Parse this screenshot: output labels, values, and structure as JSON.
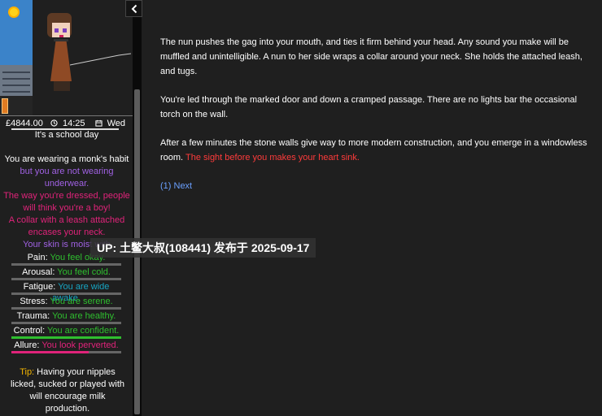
{
  "sidebar": {
    "money": "£4844.00",
    "time": "14:25",
    "weekday": "Wed",
    "day_note": "It's a school day",
    "desc": [
      {
        "text": "You are wearing a monk's habit",
        "color": "white"
      },
      {
        "text": " but you are not wearing underwear.",
        "color": "purple"
      },
      {
        "text": "The way you're dressed, people will think you're a boy!",
        "color": "pink"
      },
      {
        "text": "A collar with a leash attached encases your neck.",
        "color": "pink"
      },
      {
        "text": "Your skin is moist with",
        "color": "purple"
      }
    ],
    "stats": [
      {
        "name": "Pain",
        "sep": ": ",
        "value": "You feel okay.",
        "color": "green",
        "level": 0
      },
      {
        "name": "Arousal",
        "sep": ": ",
        "value": "You feel cold.",
        "color": "green",
        "level": 0
      },
      {
        "name": "Fatigue",
        "sep": ": ",
        "value": "You are wide awake.",
        "color": "teal",
        "level": 0
      },
      {
        "name": "Stress",
        "sep": ": ",
        "value": "You are serene.",
        "color": "green",
        "level": 0
      },
      {
        "name": "Trauma",
        "sep": ": ",
        "value": "You are healthy.",
        "color": "green",
        "level": 0
      },
      {
        "name": "Control",
        "sep": ": ",
        "value": "You are confident.",
        "color": "green",
        "level": 1.0
      },
      {
        "name": "Allure",
        "sep": ": ",
        "value": "You look perverted.",
        "color": "pink",
        "level": 0.7
      }
    ],
    "tip_label": "Tip:",
    "tip_text": " Having your nipples licked, sucked or played with will encourage milk production."
  },
  "story": {
    "p1": "The nun pushes the gag into your mouth, and ties it firm behind your head. Any sound you make will be muffled and unintelligible. A nun to her side wraps a collar around your neck. She holds the attached leash, and tugs.",
    "p2": "You're led through the marked door and down a cramped passage. There are no lights bar the occasional torch on the wall.",
    "p3_plain": "After a few minutes the stone walls give way to more modern construction, and you emerge in a windowless room. ",
    "p3_red": "The sight before you makes your heart sink.",
    "next_link": "(1) Next"
  },
  "watermark": "UP: 土鳖大叔(108441) 发布于 2025-09-17",
  "colors": {
    "white": "#ffffff",
    "purple": "#a061e3",
    "pink": "#e0237a",
    "green": "#2fbf2f",
    "teal": "#17a5c3",
    "gold": "#f1b300"
  }
}
